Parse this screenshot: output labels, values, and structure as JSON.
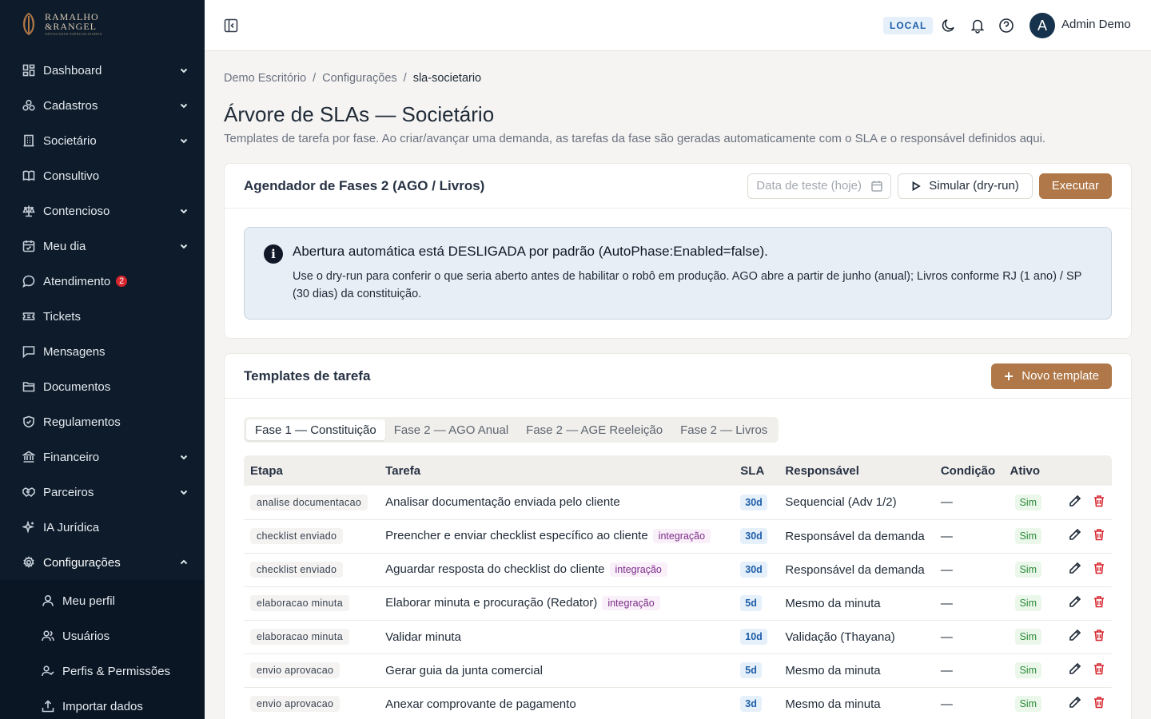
{
  "brand": {
    "line1": "RAMALHO",
    "line2": "&RANGEL",
    "line3": "ADVOGADOS ESPECIALIZADOS"
  },
  "sidebar": {
    "items": [
      {
        "label": "Dashboard",
        "icon": "dashboard-icon",
        "chevron": true
      },
      {
        "label": "Cadastros",
        "icon": "cadastros-icon",
        "chevron": true
      },
      {
        "label": "Societário",
        "icon": "building-icon",
        "chevron": true
      },
      {
        "label": "Consultivo",
        "icon": "book-icon",
        "chevron": false
      },
      {
        "label": "Contencioso",
        "icon": "scale-icon",
        "chevron": true
      },
      {
        "label": "Meu dia",
        "icon": "calendar-icon",
        "chevron": true
      },
      {
        "label": "Atendimento",
        "icon": "chat-icon",
        "chevron": false,
        "badge": "2"
      },
      {
        "label": "Tickets",
        "icon": "ticket-icon",
        "chevron": false
      },
      {
        "label": "Mensagens",
        "icon": "message-icon",
        "chevron": false
      },
      {
        "label": "Documentos",
        "icon": "folder-icon",
        "chevron": false
      },
      {
        "label": "Regulamentos",
        "icon": "shield-icon",
        "chevron": false
      },
      {
        "label": "Financeiro",
        "icon": "bank-icon",
        "chevron": true
      },
      {
        "label": "Parceiros",
        "icon": "handshake-icon",
        "chevron": true
      },
      {
        "label": "IA Jurídica",
        "icon": "sparkles-icon",
        "chevron": false
      },
      {
        "label": "Configurações",
        "icon": "gear-icon",
        "chevron": true,
        "expanded": true
      }
    ],
    "sub_items": [
      {
        "label": "Meu perfil",
        "icon": "user-icon"
      },
      {
        "label": "Usuários",
        "icon": "users-icon"
      },
      {
        "label": "Perfis & Permissões",
        "icon": "user-check-icon"
      },
      {
        "label": "Importar dados",
        "icon": "upload-icon"
      }
    ]
  },
  "topbar": {
    "env": "LOCAL",
    "avatar_initial": "A",
    "user_name": "Admin Demo"
  },
  "breadcrumb": {
    "items": [
      "Demo Escritório",
      "Configurações"
    ],
    "current": "sla-societario",
    "sep": "/"
  },
  "page": {
    "title": "Árvore de SLAs — Societário",
    "description": "Templates de tarefa por fase. Ao criar/avançar uma demanda, as tarefas da fase são geradas automaticamente com o SLA e o responsável definidos aqui."
  },
  "scheduler": {
    "title": "Agendador de Fases 2 (AGO / Livros)",
    "date_placeholder": "Data de teste (hoje)",
    "simulate_label": "Simular (dry-run)",
    "execute_label": "Executar",
    "info_title": "Abertura automática está DESLIGADA por padrão (AutoPhase:Enabled=false).",
    "info_text": "Use o dry-run para conferir o que seria aberto antes de habilitar o robô em produção. AGO abre a partir de junho (anual); Livros conforme RJ (1 ano) / SP (30 dias) da constituição."
  },
  "templates": {
    "title": "Templates de tarefa",
    "new_label": "Novo template",
    "tabs": [
      "Fase 1 — Constituição",
      "Fase 2 — AGO Anual",
      "Fase 2 — AGE Reeleição",
      "Fase 2 — Livros"
    ],
    "active_tab": 0,
    "columns": [
      "Etapa",
      "Tarefa",
      "SLA",
      "Responsável",
      "Condição",
      "Ativo"
    ],
    "rows": [
      {
        "stage": "analise documentacao",
        "task": "Analisar documentação enviada pelo cliente",
        "tag": "",
        "sla": "30d",
        "owner": "Sequencial (Adv 1/2)",
        "cond": "—",
        "active": "Sim"
      },
      {
        "stage": "checklist enviado",
        "task": "Preencher e enviar checklist específico ao cliente",
        "tag": "integração",
        "sla": "30d",
        "owner": "Responsável da demanda",
        "cond": "—",
        "active": "Sim"
      },
      {
        "stage": "checklist enviado",
        "task": "Aguardar resposta do checklist do cliente",
        "tag": "integração",
        "sla": "30d",
        "owner": "Responsável da demanda",
        "cond": "—",
        "active": "Sim"
      },
      {
        "stage": "elaboracao minuta",
        "task": "Elaborar minuta e procuração (Redator)",
        "tag": "integração",
        "sla": "5d",
        "owner": "Mesmo da minuta",
        "cond": "—",
        "active": "Sim"
      },
      {
        "stage": "elaboracao minuta",
        "task": "Validar minuta",
        "tag": "",
        "sla": "10d",
        "owner": "Validação (Thayana)",
        "cond": "—",
        "active": "Sim"
      },
      {
        "stage": "envio aprovacao",
        "task": "Gerar guia da junta comercial",
        "tag": "",
        "sla": "5d",
        "owner": "Mesmo da minuta",
        "cond": "—",
        "active": "Sim"
      },
      {
        "stage": "envio aprovacao",
        "task": "Anexar comprovante de pagamento",
        "tag": "",
        "sla": "3d",
        "owner": "Mesmo da minuta",
        "cond": "—",
        "active": "Sim"
      }
    ]
  },
  "colors": {
    "sidebar_bg": "#0d1b2a",
    "accent": "#b07848",
    "info_bg": "#e8eef5",
    "danger": "#d7262e"
  }
}
